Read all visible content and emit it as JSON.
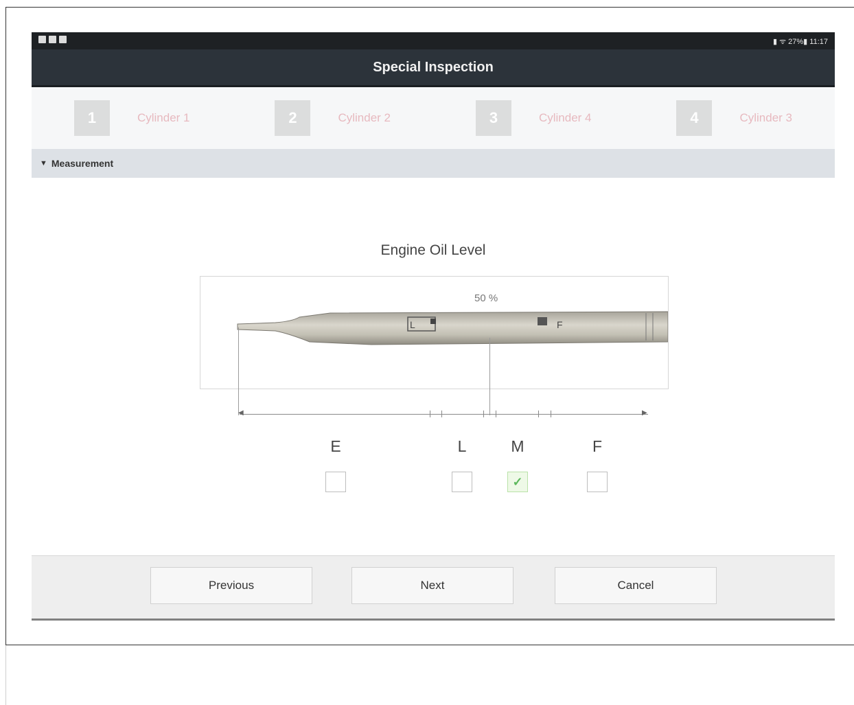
{
  "status_bar": {
    "right_text": "▮ ᯤ 27%▮ 11:17"
  },
  "title_bar": {
    "title": "Special Inspection"
  },
  "steps": [
    {
      "number": "1",
      "label": "Cylinder 1"
    },
    {
      "number": "2",
      "label": "Cylinder 2"
    },
    {
      "number": "3",
      "label": "Cylinder 4"
    },
    {
      "number": "4",
      "label": "Cylinder 3"
    }
  ],
  "section": {
    "label": "Measurement",
    "arrow_icon": "triangle-down-icon"
  },
  "gauge": {
    "title": "Engine Oil Level",
    "percent_text": "50 %",
    "percent_value": 50,
    "levels": [
      {
        "label": "E",
        "checked": false
      },
      {
        "label": "L",
        "checked": false
      },
      {
        "label": "M",
        "checked": true
      },
      {
        "label": "F",
        "checked": false
      }
    ]
  },
  "buttons": {
    "previous": "Previous",
    "next": "Next",
    "cancel": "Cancel"
  },
  "colors": {
    "title_bar": "#2c333a",
    "status_bar": "#1e2124",
    "step_label": "#e7b9bf",
    "checked_accent": "#5cb85c"
  }
}
